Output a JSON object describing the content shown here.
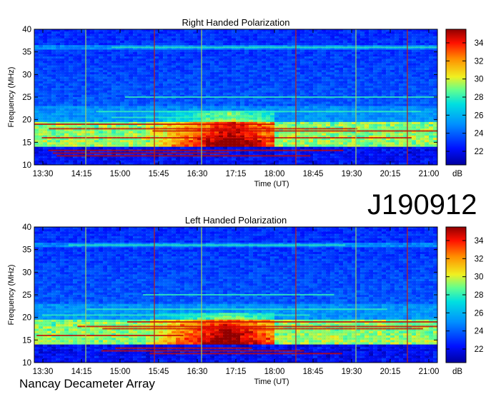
{
  "chart_data": [
    {
      "type": "heatmap",
      "title": "Right Handed Polarization",
      "xlabel": "Time (UT)",
      "ylabel": "Frequency (MHz)",
      "x_ticks": [
        "13:30",
        "14:15",
        "15:00",
        "15:45",
        "16:30",
        "17:15",
        "18:00",
        "18:45",
        "19:30",
        "20:15",
        "21:00"
      ],
      "y_ticks": [
        10,
        15,
        20,
        25,
        30,
        35,
        40
      ],
      "ylim": [
        10,
        40
      ],
      "xlim": [
        "13:20",
        "21:10"
      ],
      "colorbar": {
        "label": "dB",
        "ticks": [
          22,
          24,
          26,
          28,
          30,
          32,
          34
        ],
        "range": [
          20.5,
          35.5
        ]
      },
      "vertical_lines_ut": [
        "14:20",
        "15:40",
        "16:35",
        "18:25",
        "19:35",
        "20:35"
      ],
      "emission_burst": {
        "time_start": "15:30",
        "time_end": "18:00",
        "peak_time": "17:10",
        "freq_min": 14,
        "freq_max": 22
      }
    },
    {
      "type": "heatmap",
      "title": "Left Handed Polarization",
      "xlabel": "Time (UT)",
      "ylabel": "Frequency (MHz)",
      "x_ticks": [
        "13:30",
        "14:15",
        "15:00",
        "15:45",
        "16:30",
        "17:15",
        "18:00",
        "18:45",
        "19:30",
        "20:15",
        "21:00"
      ],
      "y_ticks": [
        10,
        15,
        20,
        25,
        30,
        35,
        40
      ],
      "ylim": [
        10,
        40
      ],
      "xlim": [
        "13:20",
        "21:10"
      ],
      "colorbar": {
        "label": "dB",
        "ticks": [
          22,
          24,
          26,
          28,
          30,
          32,
          34
        ],
        "range": [
          20.5,
          35.5
        ]
      },
      "vertical_lines_ut": [
        "14:20",
        "15:40",
        "16:35",
        "18:25",
        "19:35",
        "20:35"
      ],
      "emission_burst": {
        "time_start": "15:30",
        "time_end": "18:00",
        "peak_time": "17:05",
        "freq_min": 14,
        "freq_max": 21
      }
    }
  ],
  "observation_id": "J190912",
  "observatory": "Nancay Decameter Array"
}
